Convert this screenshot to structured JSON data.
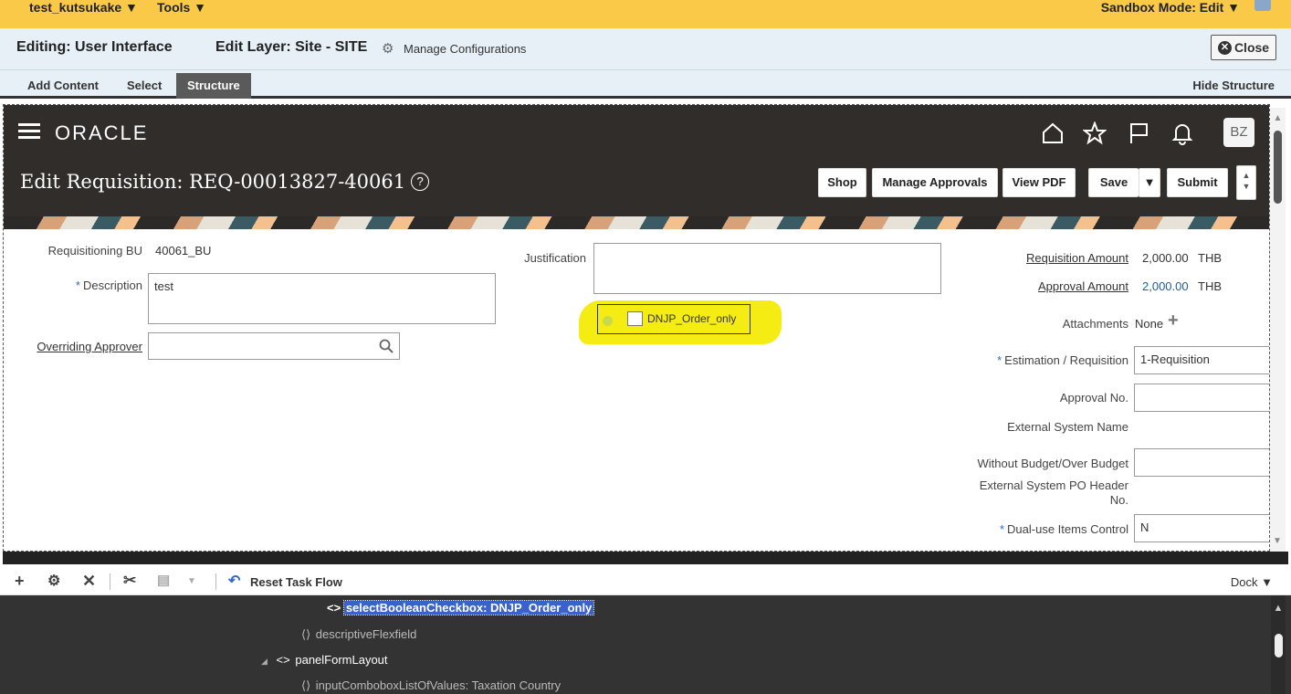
{
  "topbar": {
    "user": "test_kutsukake ▼",
    "tools": "Tools ▼",
    "sandbox": "Sandbox Mode: Edit ▼"
  },
  "editbar": {
    "editing": "Editing: User Interface",
    "layer": "Edit Layer: Site - SITE",
    "manage": "Manage Configurations",
    "close": "Close"
  },
  "tabs": {
    "add": "Add Content",
    "select": "Select",
    "structure": "Structure",
    "hide": "Hide Structure"
  },
  "app": {
    "logo": "ORACLE",
    "avatar": "BZ",
    "title": "Edit Requisition: REQ-00013827-40061",
    "help": "?",
    "buttons": {
      "shop": "Shop",
      "manage_approvals": "Manage Approvals",
      "view_pdf": "View PDF",
      "save": "Save",
      "save_menu": "▼",
      "submit": "Submit"
    }
  },
  "form": {
    "req_bu_label": "Requisitioning BU",
    "req_bu_value": "40061_BU",
    "description_label": "Description",
    "description_value": "test",
    "overriding_label": "Overriding Approver",
    "overriding_value": "",
    "justification_label": "Justification",
    "justification_value": "",
    "checkbox_label": "DNJP_Order_only",
    "req_amount_label": "Requisition Amount",
    "req_amount_value": "2,000.00",
    "req_amount_cur": "THB",
    "approval_amount_label": "Approval Amount",
    "approval_amount_value": "2,000.00",
    "approval_amount_cur": "THB",
    "attachments_label": "Attachments",
    "attachments_value": "None",
    "estimation_label": "Estimation / Requisition",
    "estimation_value": "1-Requisition",
    "approval_no_label": "Approval No.",
    "external_name_label": "External System Name",
    "without_budget_label": "Without Budget/Over Budget",
    "ext_po_label_1": "External System PO Header",
    "ext_po_label_2": "No.",
    "dual_use_label": "Dual-use Items Control",
    "dual_use_value": "N"
  },
  "structure": {
    "reset": "Reset Task Flow",
    "dock": "Dock ▼",
    "nodes": [
      "selectBooleanCheckbox: DNJP_Order_only",
      "descriptiveFlexfield",
      "panelFormLayout",
      "inputComboboxListOfValues: Taxation Country"
    ]
  },
  "colors": {
    "sandbox_bar": "#f9c947",
    "app_header": "#312d2a",
    "highlight": "#f5ec14",
    "tree_bg": "#333333"
  }
}
